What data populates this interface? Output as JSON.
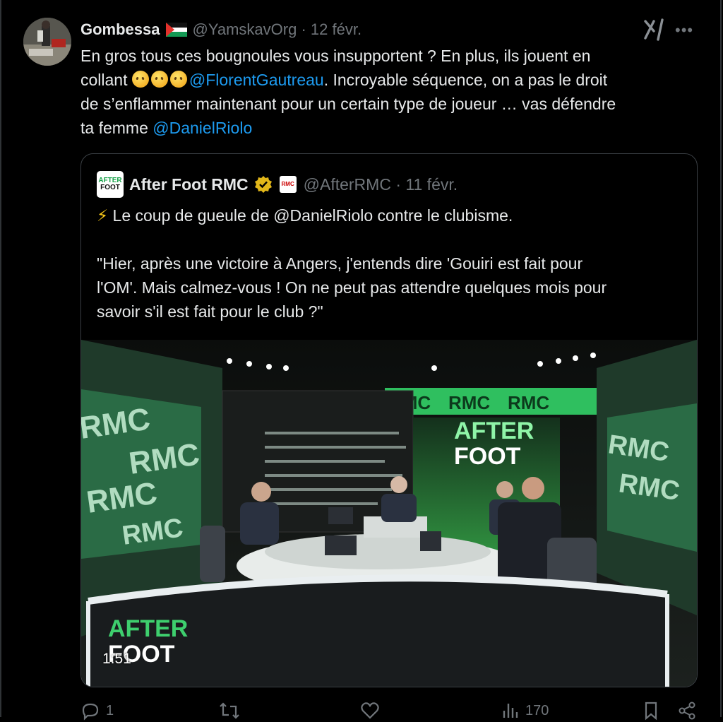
{
  "tweet": {
    "author_name": "Gombessa",
    "handle": "@YamskavOrg",
    "date_sep": " · ",
    "date": "12 févr.",
    "text": {
      "line1": "En gros tous ces bougnoules vous insupportent ? En plus, ils jouent en",
      "line2_pre": "collant ",
      "mention1": "@FlorentGautreau",
      "line2_post": ". Incroyable séquence, on a pas le droit",
      "line3": "de s’enflammer maintenant pour un certain type de joueur … vas défendre",
      "line4_pre": "ta femme ",
      "mention2": "@DanielRiolo"
    }
  },
  "quoted": {
    "logo_line1": "AFTER",
    "logo_line2": "FOOT",
    "author_name": "After Foot RMC",
    "badge_text": "RMC",
    "handle": "@AfterRMC",
    "date_sep": " · ",
    "date": "11 févr.",
    "text": {
      "line1_emoji": "⚡",
      "line1": " Le coup de gueule de @DanielRiolo contre le clubisme.",
      "line3": "\"Hier, après une victoire à Angers, j'entends dire 'Gouiri est fait pour",
      "line4": "l'OM'. Mais calmez-vous ! On ne peut pas attendre quelques mois pour",
      "line5": "savoir s'il est fait pour le club ?\""
    },
    "video": {
      "duration": "1:51",
      "wall_brand": "RMC",
      "screen_line1": "AFTER",
      "screen_line2": "FOOT",
      "desk_line1": "AFTER",
      "desk_line2": "FOOT"
    }
  },
  "actions": {
    "replies": "1",
    "views": "170"
  },
  "colors": {
    "background": "#000000",
    "text": "#e7e9ea",
    "muted": "#71767b",
    "link": "#1d9bf0",
    "rmc_green": "#3ecf6e"
  }
}
